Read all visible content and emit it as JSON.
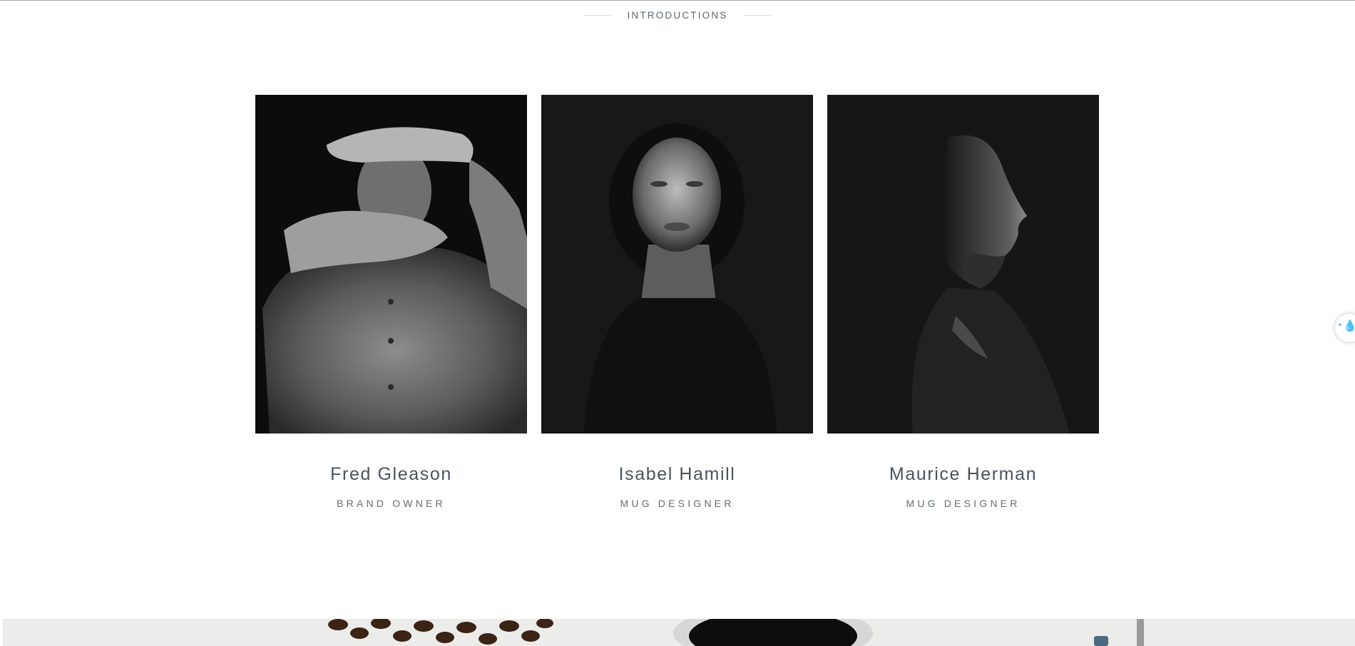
{
  "section": {
    "heading": "INTRODUCTIONS"
  },
  "team": [
    {
      "name": "Fred Gleason",
      "role": "BRAND OWNER"
    },
    {
      "name": "Isabel Hamill",
      "role": "MUG DESIGNER"
    },
    {
      "name": "Maurice Herman",
      "role": "MUG DESIGNER"
    }
  ],
  "colors": {
    "text_dark": "#4b5260",
    "text_muted": "#636a76",
    "photo_background": "#141414",
    "accent_blue": "#2f7fd6"
  },
  "icons": {
    "floating_tool": "water-drop-icon"
  }
}
